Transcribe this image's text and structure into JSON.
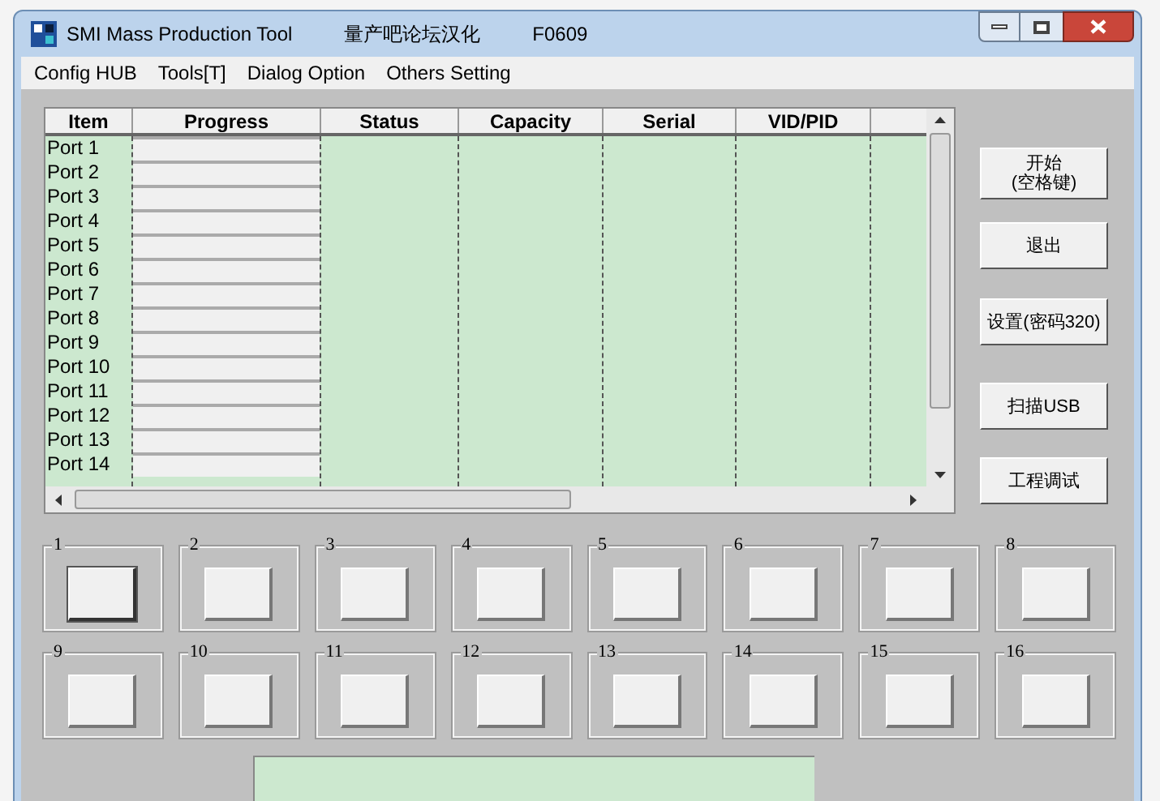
{
  "window": {
    "title": "SMI Mass Production Tool",
    "subtitle": "量产吧论坛汉化",
    "version": "F0609"
  },
  "menu": [
    "Config HUB",
    "Tools[T]",
    "Dialog Option",
    "Others Setting"
  ],
  "table": {
    "columns": [
      "Item",
      "Progress",
      "Status",
      "Capacity",
      "Serial",
      "VID/PID"
    ],
    "rows": [
      {
        "item": "Port 1",
        "level": 0
      },
      {
        "item": "Port 2",
        "level": 0
      },
      {
        "item": "Port 3",
        "level": 0
      },
      {
        "item": "Port 4",
        "level": 0
      },
      {
        "item": "Port 5",
        "level": 0
      },
      {
        "item": "Port 6",
        "level": 0
      },
      {
        "item": "Port 7",
        "level": 0
      },
      {
        "item": "Port 8",
        "level": 0
      },
      {
        "item": "Port 9",
        "level": 0
      },
      {
        "item": "Port 10",
        "level": 0
      },
      {
        "item": "Port 11",
        "level": 0
      },
      {
        "item": "Port 12",
        "level": 0
      },
      {
        "item": "Port 13",
        "level": 0
      },
      {
        "item": "Port 14",
        "level": 0
      }
    ]
  },
  "buttons": [
    {
      "label": "开始",
      "label_2": "(空格键)"
    },
    {
      "label": "退出"
    },
    {
      "label": "设置(密码320)"
    },
    {
      "label": "扫描USB"
    },
    {
      "label": "工程调试"
    }
  ],
  "ports": [
    {
      "label": "1",
      "selected": true
    },
    {
      "label": "2",
      "selected": false
    },
    {
      "label": "3",
      "selected": false
    },
    {
      "label": "4",
      "selected": false
    },
    {
      "label": "5",
      "selected": false
    },
    {
      "label": "6",
      "selected": false
    },
    {
      "label": "7",
      "selected": false
    },
    {
      "label": "8",
      "selected": false
    },
    {
      "label": "9",
      "selected": false
    },
    {
      "label": "10",
      "selected": false
    },
    {
      "label": "11",
      "selected": false
    },
    {
      "label": "12",
      "selected": false
    },
    {
      "label": "13",
      "selected": false
    },
    {
      "label": "14",
      "selected": false
    },
    {
      "label": "15",
      "selected": false
    },
    {
      "label": "16",
      "selected": false
    }
  ]
}
